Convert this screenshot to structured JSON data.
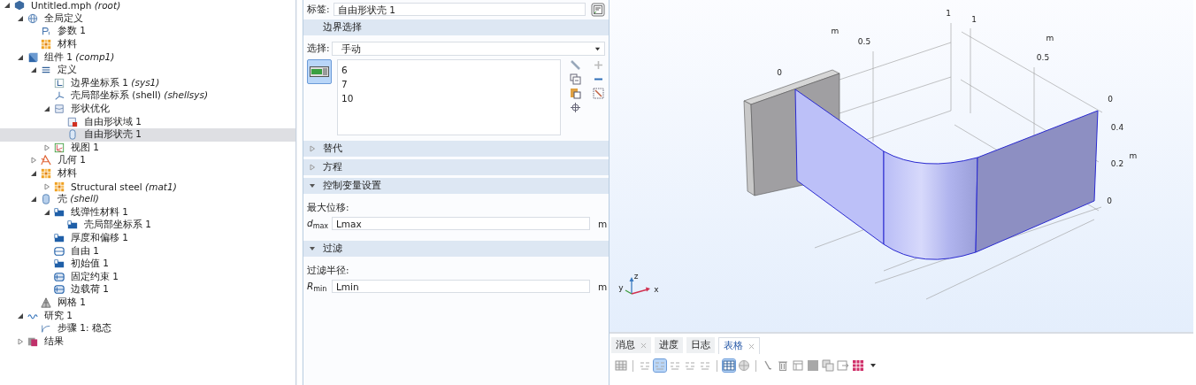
{
  "model_tree": {
    "items": [
      {
        "label": "Untitled.mph *(root)*",
        "kind": "root",
        "selected": false,
        "expanded": true,
        "children": [
          {
            "label": "全局定义",
            "kind": "globe",
            "selected": false,
            "expanded": true,
            "children": [
              {
                "label": "参数 1",
                "kind": "param",
                "selected": false
              },
              {
                "label": "材料",
                "kind": "material",
                "selected": false
              }
            ]
          },
          {
            "label": "组件 1 *(comp1)*",
            "kind": "component",
            "selected": false,
            "expanded": true,
            "children": [
              {
                "label": "定义",
                "kind": "definition",
                "selected": false,
                "expanded": true,
                "children": [
                  {
                    "label": "边界坐标系 1 *(sys1)*",
                    "kind": "coord",
                    "selected": false
                  },
                  {
                    "label": "壳局部坐标系 (shell) *(shellsys)*",
                    "kind": "coordshell",
                    "selected": false
                  },
                  {
                    "label": "形状优化",
                    "kind": "shapeopt",
                    "selected": false,
                    "expanded": true,
                    "children": [
                      {
                        "label": "自由形状域 1",
                        "kind": "freedomain",
                        "selected": false
                      },
                      {
                        "label": "自由形状壳 1",
                        "kind": "freeshell",
                        "selected": true
                      }
                    ]
                  },
                  {
                    "label": "视图 1",
                    "kind": "view",
                    "selected": false,
                    "expanded": false
                  }
                ]
              },
              {
                "label": "几何 1",
                "kind": "geometry",
                "selected": false,
                "expanded": false
              },
              {
                "label": "材料",
                "kind": "material",
                "selected": false,
                "expanded": true,
                "children": [
                  {
                    "label": "Structural steel *(mat1)*",
                    "kind": "material",
                    "selected": false,
                    "expanded": false
                  }
                ]
              },
              {
                "label": "壳 *(shell)*",
                "kind": "shell",
                "selected": false,
                "expanded": true,
                "children": [
                  {
                    "label": "线弹性材料 1",
                    "kind": "folder",
                    "selected": false,
                    "expanded": true,
                    "children": [
                      {
                        "label": "壳局部坐标系 1",
                        "kind": "folder",
                        "selected": false
                      }
                    ]
                  },
                  {
                    "label": "厚度和偏移 1",
                    "kind": "folder",
                    "selected": false
                  },
                  {
                    "label": "自由 1",
                    "kind": "boundary",
                    "selected": false
                  },
                  {
                    "label": "初始值 1",
                    "kind": "folder",
                    "selected": false
                  },
                  {
                    "label": "固定约束 1",
                    "kind": "edge",
                    "selected": false
                  },
                  {
                    "label": "边载荷 1",
                    "kind": "edge",
                    "selected": false
                  }
                ]
              },
              {
                "label": "网格 1",
                "kind": "mesh",
                "selected": false
              }
            ]
          },
          {
            "label": "研究 1",
            "kind": "study",
            "selected": false,
            "expanded": true,
            "children": [
              {
                "label": "步骤 1: 稳态",
                "kind": "step",
                "selected": false
              }
            ]
          },
          {
            "label": "结果",
            "kind": "results",
            "selected": false,
            "expanded": false
          }
        ]
      }
    ]
  },
  "settings": {
    "label_caption": "标签:",
    "label_value": "自由形状壳 1",
    "sections": [
      {
        "kind": "selection",
        "title": "边界选择",
        "select_caption": "选择:",
        "mode": "手动",
        "entries": [
          "6",
          "7",
          "10"
        ],
        "active": true
      },
      {
        "kind": "plain",
        "title": "替代",
        "expanded": false
      },
      {
        "kind": "plain",
        "title": "方程",
        "expanded": false
      },
      {
        "kind": "quantity",
        "title": "控制变量设置",
        "expanded": true,
        "caption": "最大位移:",
        "symbol": "*d*$_{max}$",
        "value": "Lmax",
        "unit": "m"
      },
      {
        "kind": "quantity",
        "title": "过滤",
        "expanded": true,
        "caption": "过滤半径:",
        "symbol": "*R*$_{min}$",
        "value": "Lmin",
        "unit": "m"
      }
    ]
  },
  "graphics": {
    "axis_labels": [
      "1",
      "1",
      "m",
      "0.5",
      "m",
      "0.5",
      "0",
      "0",
      "0.4",
      "m",
      "0.2",
      "0"
    ],
    "triad_labels": [
      "y",
      "z",
      "x"
    ]
  },
  "bottom_panel": {
    "tabs": [
      {
        "label": "消息",
        "closable": true,
        "selected": false
      },
      {
        "label": "进度",
        "closable": false,
        "selected": false
      },
      {
        "label": "日志",
        "closable": false,
        "selected": false
      },
      {
        "label": "表格",
        "closable": true,
        "selected": true
      }
    ],
    "toolbar": [
      {
        "kind": "cells",
        "on": false
      },
      {
        "kind": "sep"
      },
      {
        "kind": "format",
        "on": false
      },
      {
        "kind": "format",
        "on": true
      },
      {
        "kind": "format",
        "on": false
      },
      {
        "kind": "format",
        "on": false
      },
      {
        "kind": "format",
        "on": false
      },
      {
        "kind": "sep"
      },
      {
        "kind": "table",
        "on": true
      },
      {
        "kind": "sphere",
        "on": false
      },
      {
        "kind": "sep"
      },
      {
        "kind": "brush",
        "on": false
      },
      {
        "kind": "trash",
        "on": false
      },
      {
        "kind": "frame",
        "on": false
      },
      {
        "kind": "square",
        "on": false
      },
      {
        "kind": "copy",
        "on": false
      },
      {
        "kind": "export",
        "on": false
      },
      {
        "kind": "chart",
        "on": false
      },
      {
        "kind": "dropdown",
        "on": false
      }
    ]
  }
}
